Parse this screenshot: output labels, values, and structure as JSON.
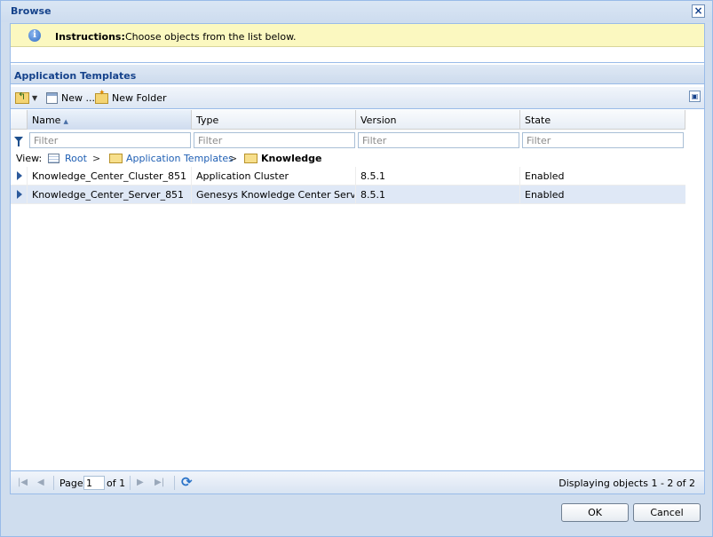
{
  "window": {
    "title": "Browse",
    "close_glyph": "×"
  },
  "instructions": {
    "label": "Instructions:",
    "text": "Choose objects from the list below.",
    "icon": "info-icon"
  },
  "panel": {
    "title": "Application Templates"
  },
  "toolbar": {
    "up_icon": "folder-up-icon",
    "new_label": "New ...",
    "new_folder_label": "New Folder"
  },
  "grid": {
    "columns": [
      "Name",
      "Type",
      "Version",
      "State"
    ],
    "sorted_column": "Name",
    "filter_placeholder": "Filter",
    "rows": [
      {
        "name": "Knowledge_Center_Cluster_851",
        "type": "Application Cluster",
        "version": "8.5.1",
        "state": "Enabled"
      },
      {
        "name": "Knowledge_Center_Server_851",
        "type": "Genesys Knowledge Center Server",
        "version": "8.5.1",
        "state": "Enabled"
      }
    ]
  },
  "breadcrumb": {
    "view_label": "View:",
    "root": "Root",
    "separator": ">",
    "parent": "Application Templates",
    "current": "Knowledge"
  },
  "paging": {
    "page_label": "Page",
    "page_value": "1",
    "of_label": "of 1",
    "display_message": "Displaying objects 1 - 2 of 2"
  },
  "footer": {
    "ok_label": "OK",
    "cancel_label": "Cancel"
  },
  "colors": {
    "header_text": "#15428b",
    "selected_row": "#dfe8f6",
    "instructions_bg": "#fbf8c0"
  }
}
